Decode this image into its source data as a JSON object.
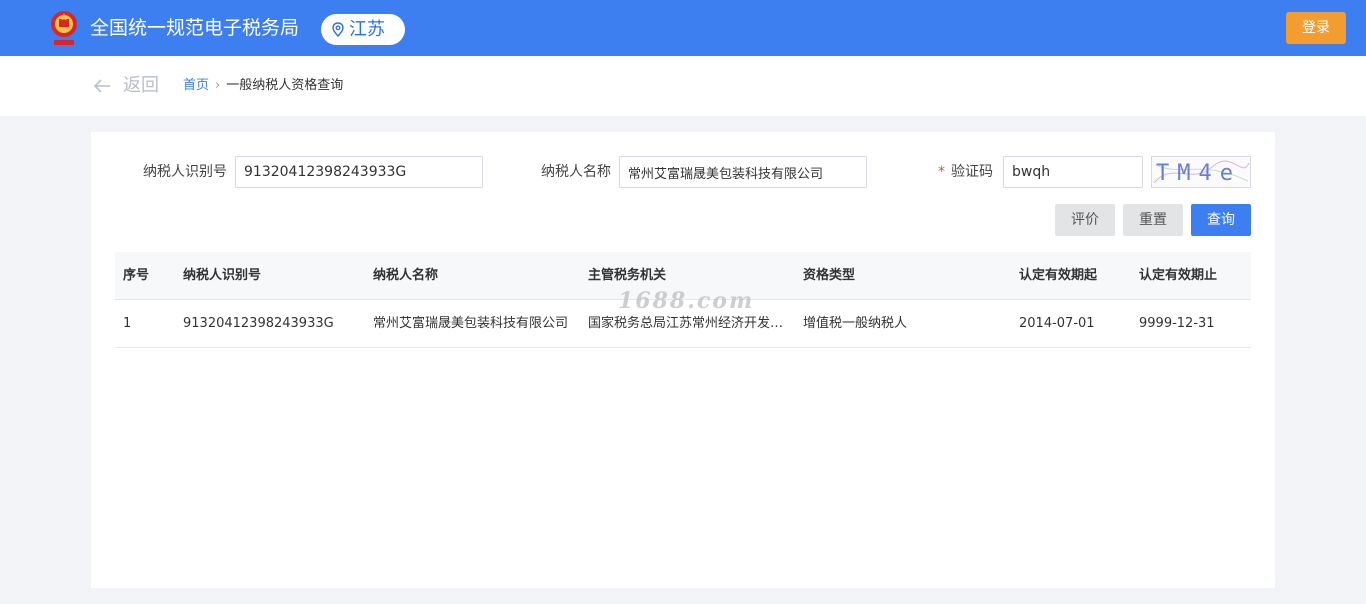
{
  "header": {
    "site_title": "全国统一规范电子税务局",
    "region": "江苏",
    "login_label": "登录",
    "emblem_icon": "national-emblem-icon",
    "location_icon": "location-pin-icon",
    "brand_color": "#3d7ef0",
    "login_color": "#f39c2f"
  },
  "nav": {
    "back_label": "返回",
    "back_icon": "arrow-left-icon",
    "breadcrumb": {
      "home": "首页",
      "separator": "›",
      "current": "一般纳税人资格查询"
    }
  },
  "form": {
    "taxpayer_id_label": "纳税人识别号",
    "taxpayer_id_value": "91320412398243933G",
    "taxpayer_name_label": "纳税人名称",
    "taxpayer_name_value": "常州艾富瑞晟美包装科技有限公司",
    "required_mark": "*",
    "captcha_label": "验证码",
    "captcha_value": "bwqh",
    "captcha_image_text": "TM4e"
  },
  "actions": {
    "evaluate_label": "评价",
    "reset_label": "重置",
    "query_label": "查询"
  },
  "table": {
    "columns": [
      "序号",
      "纳税人识别号",
      "纳税人名称",
      "主管税务机关",
      "资格类型",
      "认定有效期起",
      "认定有效期止"
    ],
    "rows": [
      [
        "1",
        "91320412398243933G",
        "常州艾富瑞晟美包装科技有限公司",
        "国家税务总局江苏常州经济开发区税务局",
        "增值税一般纳税人",
        "2014-07-01",
        "9999-12-31"
      ]
    ]
  },
  "watermark": "1688.com"
}
